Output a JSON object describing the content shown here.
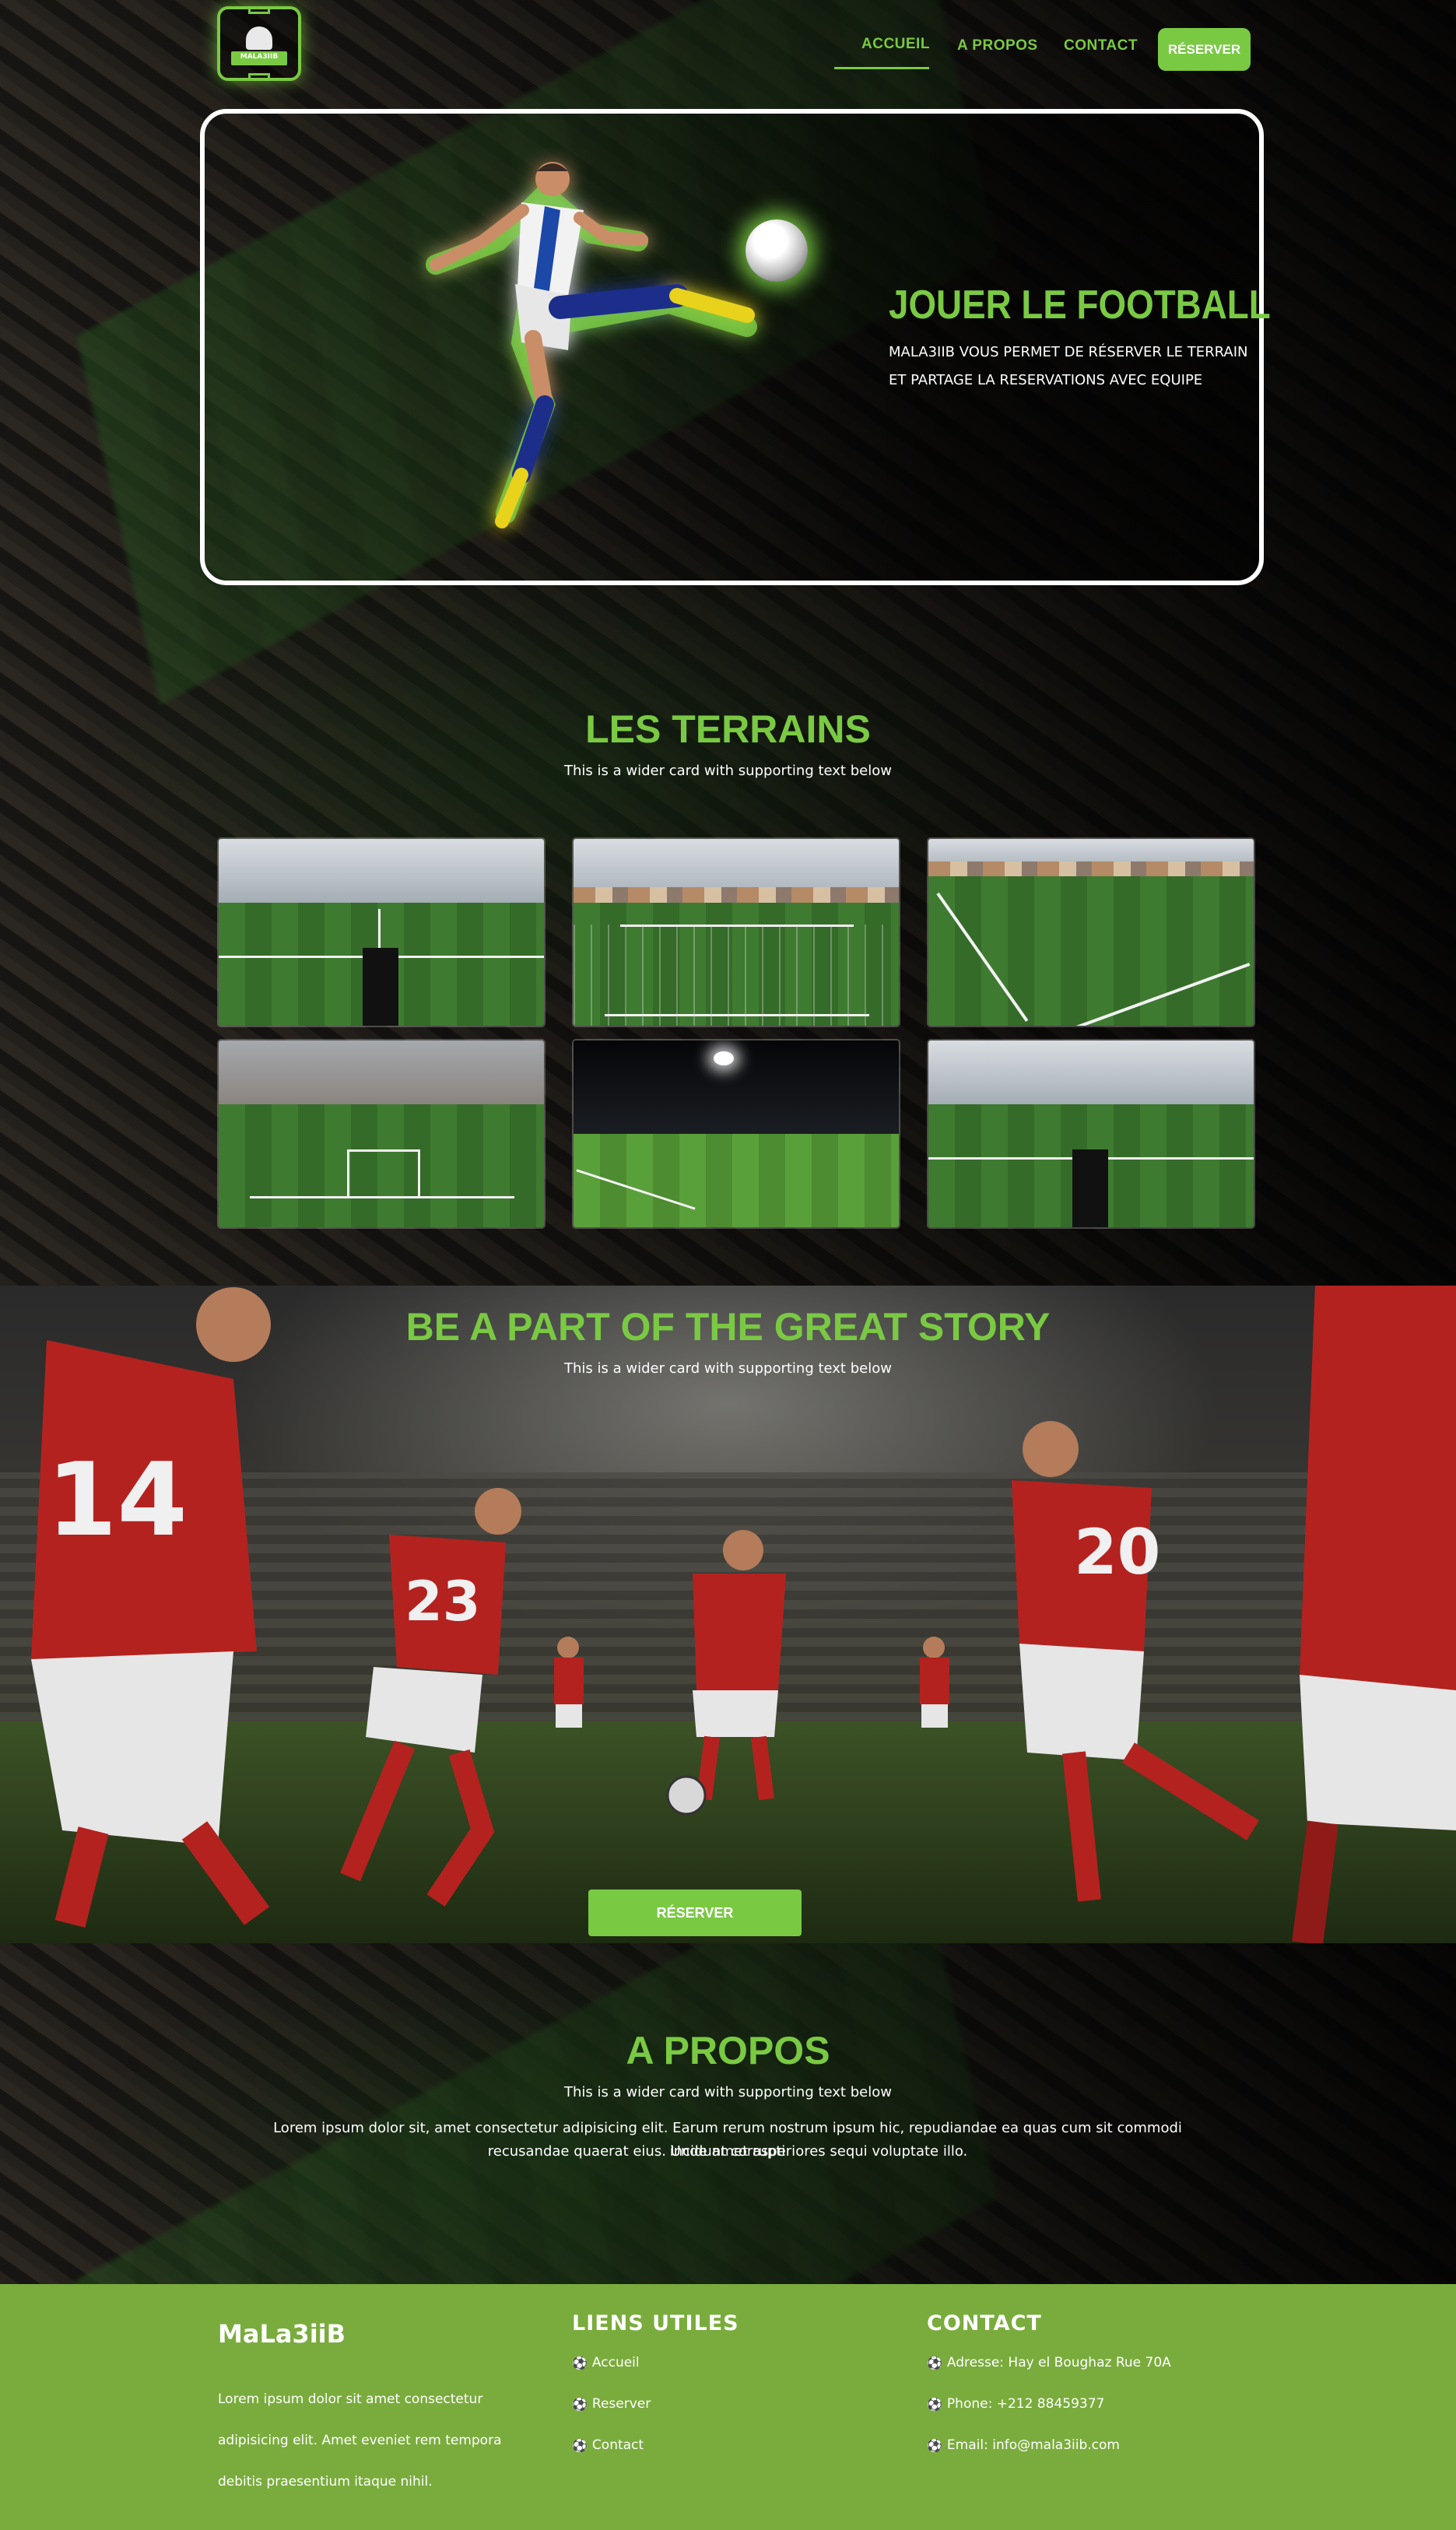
{
  "nav": {
    "logo_text": "MALA3IIB",
    "items": [
      {
        "label": "ACCUEIL"
      },
      {
        "label": "A PROPOS"
      },
      {
        "label": "CONTACT"
      }
    ],
    "cta_label": "RÉSERVER",
    "accent_color": "#7ac943"
  },
  "hero": {
    "title": "JOUER LE FOOTBALL",
    "line1": "MALA3IIB VOUS PERMET DE RÉSERVER LE TERRAIN",
    "line2": "ET PARTAGE LA RESERVATIONS AVEC EQUIPE"
  },
  "terrains": {
    "title": "LES TERRAINS",
    "subtitle": "This is a wider card with supporting text below"
  },
  "story": {
    "title": "BE A PART OF THE GREAT STORY",
    "subtitle": "This is a wider card with supporting text below",
    "cta_label": "RÉSERVER"
  },
  "propos": {
    "title": "A PROPOS",
    "subtitle": "This is a wider card with supporting text below",
    "text_line1": "Lorem ipsum dolor sit, amet consectetur adipisicing elit. Earum rerum nostrum ipsum hic, repudiandae ea quas cum sit commodi incidunt corrupti",
    "text_line2": "recusandae quaerat eius. Unde amet asperiores sequi voluptate illo."
  },
  "footer": {
    "brand": "MaLa3iiB",
    "desc_line1": "Lorem ipsum dolor sit amet consectetur",
    "desc_line2": "adipisicing elit. Amet eveniet rem tempora",
    "desc_line3": "debitis praesentium itaque nihil.",
    "links_title": "LIENS UTILES",
    "links": [
      {
        "label": "Accueil"
      },
      {
        "label": "Reserver"
      },
      {
        "label": "Contact"
      }
    ],
    "contact_title": "CONTACT",
    "contact": [
      {
        "label": "Adresse: Hay el Boughaz Rue 70A"
      },
      {
        "label": "Phone: +212 88459377"
      },
      {
        "label": "Email: info@mala3iib.com"
      }
    ],
    "bullet_icon": "⚽",
    "bg_color": "#7aac3d"
  },
  "jerseys": {
    "numbers": [
      "14",
      "23",
      "20"
    ]
  }
}
